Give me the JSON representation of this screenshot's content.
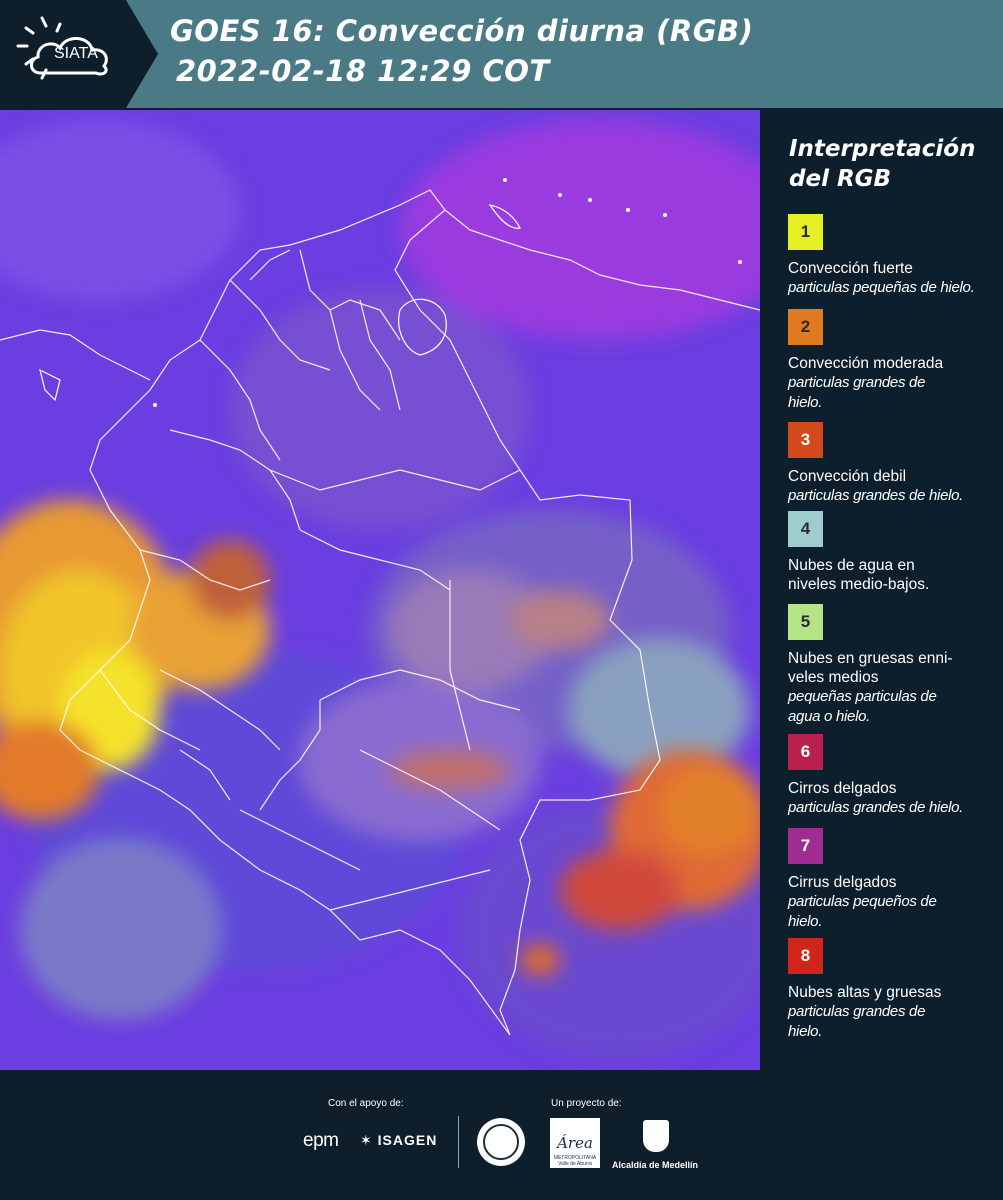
{
  "header": {
    "logo_text": "SIATA",
    "title_line1": "GOES 16: Convección diurna (RGB)",
    "title_line2": "2022-02-18 12:29 COT"
  },
  "legend": {
    "title_line1": "Interpretación",
    "title_line2": "del RGB",
    "items": [
      {
        "number": "1",
        "color": "#e6ee24",
        "label": "Convección fuerte",
        "desc": "particulas pequeñas de hielo."
      },
      {
        "number": "2",
        "color": "#e07b22",
        "label": "Convección moderada",
        "desc": "particulas grandes de hielo."
      },
      {
        "number": "3",
        "color": "#d24a1b",
        "label": "Convección debil",
        "desc": "particulas grandes de hielo."
      },
      {
        "number": "4",
        "color": "#9fcccc",
        "label": "Nubes de agua en niveles medio-bajos.",
        "desc": ""
      },
      {
        "number": "5",
        "color": "#b4e486",
        "label": "Nubes en gruesas enni- veles medios",
        "desc": "pequeñas particulas de agua o hielo."
      },
      {
        "number": "6",
        "color": "#b8214e",
        "label": "Cirros delgados",
        "desc": "particulas grandes de hielo."
      },
      {
        "number": "7",
        "color": "#a02b92",
        "label": "Cirrus delgados",
        "desc": "particulas pequeños de hielo."
      },
      {
        "number": "8",
        "color": "#d0251a",
        "label": "Nubes altas y gruesas",
        "desc": "particulas grandes de hielo."
      }
    ]
  },
  "footer": {
    "support_label": "Con el apoyo de:",
    "project_label": "Un proyecto de:",
    "epm": "epm",
    "isagen": "ISAGEN",
    "area_logo": "Área",
    "area_sub": "METROPOLITANA Valle de Aburrá",
    "alcaldia": "Alcaldía de Medellín"
  }
}
